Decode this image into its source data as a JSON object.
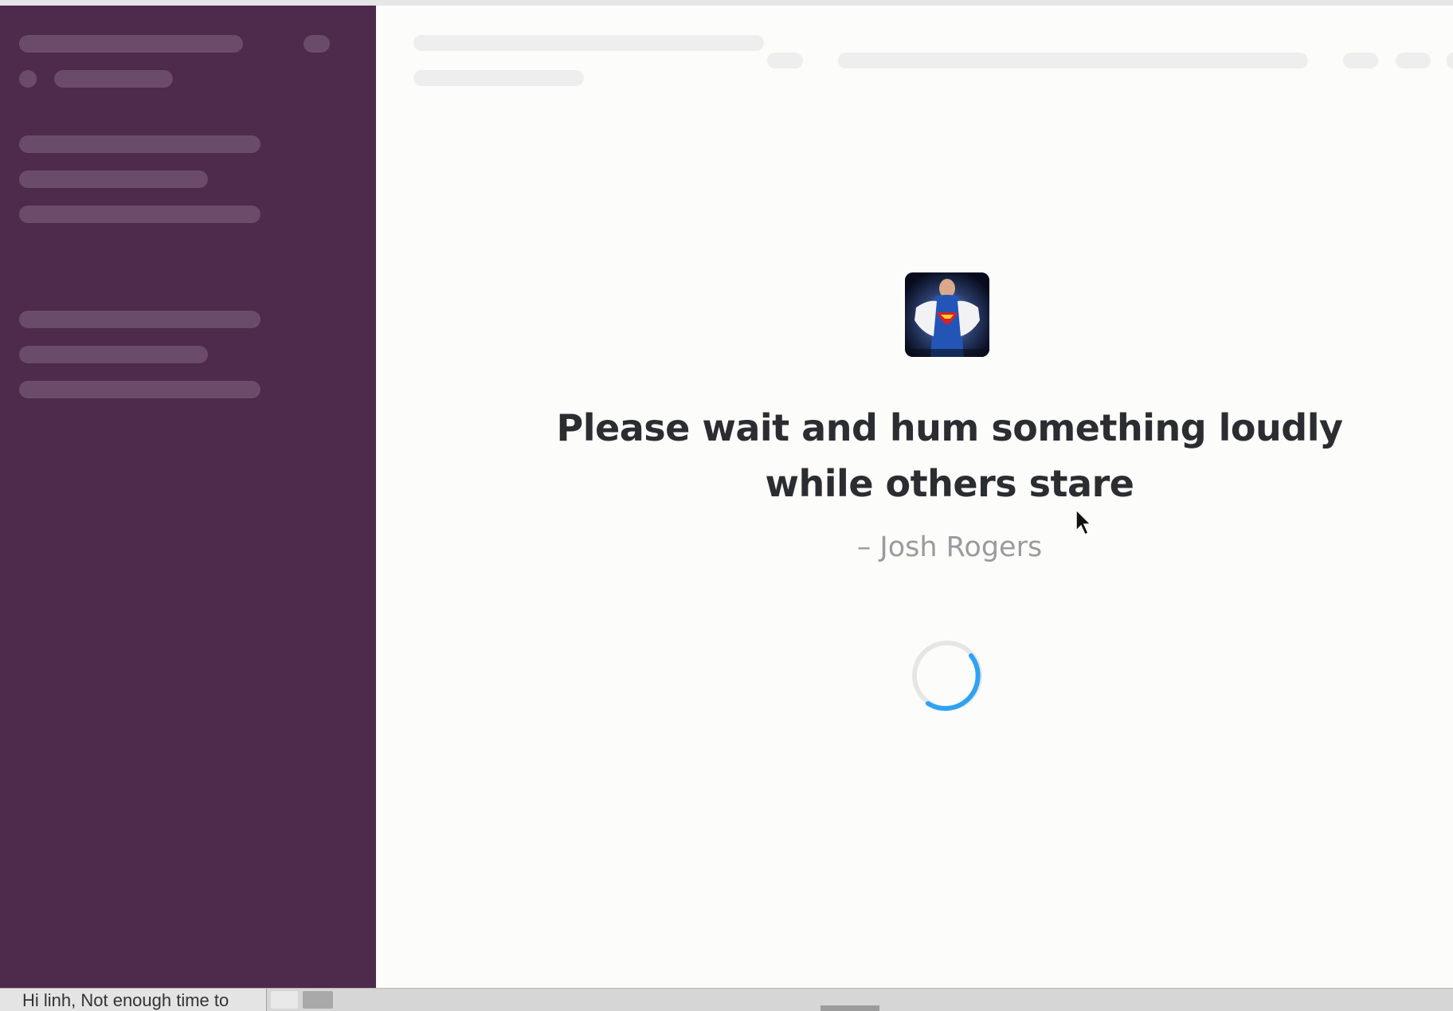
{
  "main": {
    "quote": "Please wait and hum something loudly while others stare",
    "author": "– Josh Rogers"
  },
  "avatar": {
    "alt": "Superman shirt-opening avatar"
  },
  "taskbar": {
    "item_label": "Hi linh, Not enough time to"
  },
  "colors": {
    "sidebar_bg": "#4e2a4d",
    "spinner_accent": "#2ea3f2",
    "quote_text": "#2c2d30",
    "author_text": "#9b9b9d"
  },
  "icons": [
    "loading-spinner-icon",
    "mouse-cursor-icon",
    "avatar-image"
  ]
}
